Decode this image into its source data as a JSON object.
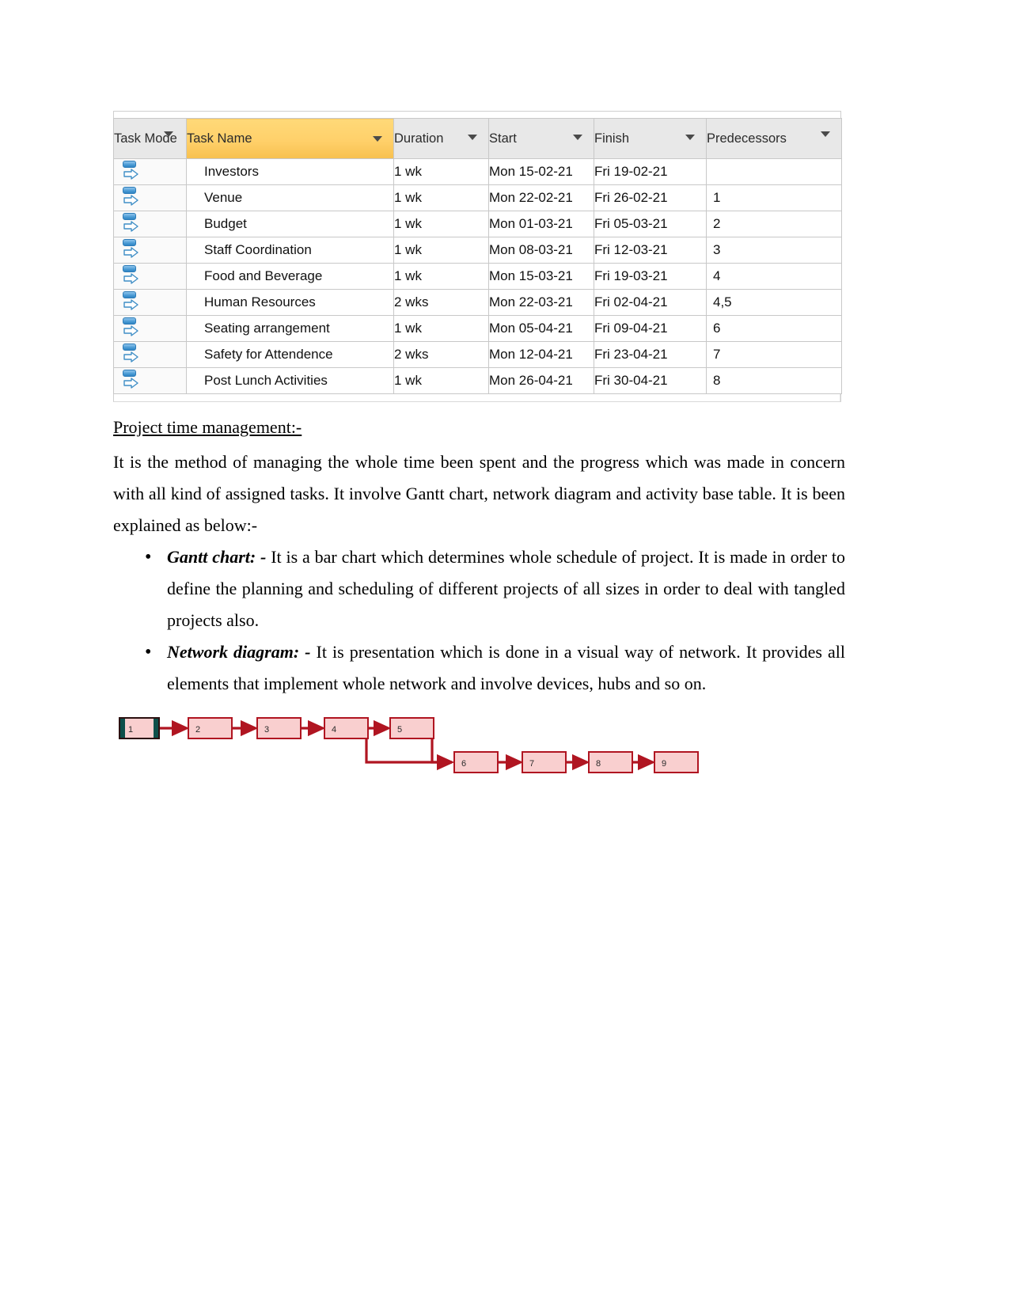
{
  "project_table": {
    "columns": [
      {
        "key": "task_mode",
        "label": "Task Mode"
      },
      {
        "key": "task_name",
        "label": "Task Name"
      },
      {
        "key": "duration",
        "label": "Duration"
      },
      {
        "key": "start",
        "label": "Start"
      },
      {
        "key": "finish",
        "label": "Finish"
      },
      {
        "key": "predecessors",
        "label": "Predecessors"
      }
    ],
    "highlight_column": "Task Name",
    "highlight_color": "#ffd06a",
    "header_bg": "#e8e8e8",
    "mode_icon": "auto-schedule-icon",
    "rows": [
      {
        "task_name": "Investors",
        "duration": "1 wk",
        "start": "Mon 15-02-21",
        "finish": "Fri 19-02-21",
        "predecessors": ""
      },
      {
        "task_name": "Venue",
        "duration": "1 wk",
        "start": "Mon 22-02-21",
        "finish": "Fri 26-02-21",
        "predecessors": "1"
      },
      {
        "task_name": "Budget",
        "duration": "1 wk",
        "start": "Mon 01-03-21",
        "finish": "Fri 05-03-21",
        "predecessors": "2"
      },
      {
        "task_name": "Staff Coordination",
        "duration": "1 wk",
        "start": "Mon 08-03-21",
        "finish": "Fri 12-03-21",
        "predecessors": "3"
      },
      {
        "task_name": "Food and Beverage",
        "duration": "1 wk",
        "start": "Mon 15-03-21",
        "finish": "Fri 19-03-21",
        "predecessors": "4"
      },
      {
        "task_name": "Human Resources",
        "duration": "2 wks",
        "start": "Mon 22-03-21",
        "finish": "Fri 02-04-21",
        "predecessors": "4,5"
      },
      {
        "task_name": "Seating arrangement",
        "duration": "1 wk",
        "start": "Mon 05-04-21",
        "finish": "Fri 09-04-21",
        "predecessors": "6"
      },
      {
        "task_name": "Safety for Attendence",
        "duration": "2 wks",
        "start": "Mon 12-04-21",
        "finish": "Fri 23-04-21",
        "predecessors": "7"
      },
      {
        "task_name": "Post Lunch Activities",
        "duration": "1 wk",
        "start": "Mon 26-04-21",
        "finish": "Fri 30-04-21",
        "predecessors": "8"
      }
    ]
  },
  "document": {
    "heading": "Project time management:-",
    "intro_paragraph": "It is the method of managing the whole time been spent and the progress which was made in concern with all kind of assigned tasks. It involve Gantt chart, network diagram and activity base table. It is been explained as below:-",
    "bullets": [
      {
        "term": "Gantt  chart:",
        "dash": " - ",
        "text": "It is a bar chart which determines whole schedule of project. It is made in order to define the planning and scheduling of different projects of all sizes in order to deal with tangled projects also."
      },
      {
        "term": "Network diagram:",
        "dash": " - ",
        "text": "It is presentation which is done in a visual way of network. It provides all elements that implement whole network and involve devices, hubs and so on."
      }
    ]
  },
  "network_diagram": {
    "node_fill": "#f9cfcf",
    "node_border": "#b01521",
    "connector_color": "#b01521",
    "start_node_accent": "#0d4f4a",
    "top_row": [
      "1",
      "2",
      "3",
      "4",
      "5"
    ],
    "bottom_row": [
      "6",
      "7",
      "8",
      "9"
    ],
    "edges": [
      "1-2",
      "2-3",
      "3-4",
      "4-5",
      "4-6",
      "5-6",
      "6-7",
      "7-8",
      "8-9"
    ]
  }
}
